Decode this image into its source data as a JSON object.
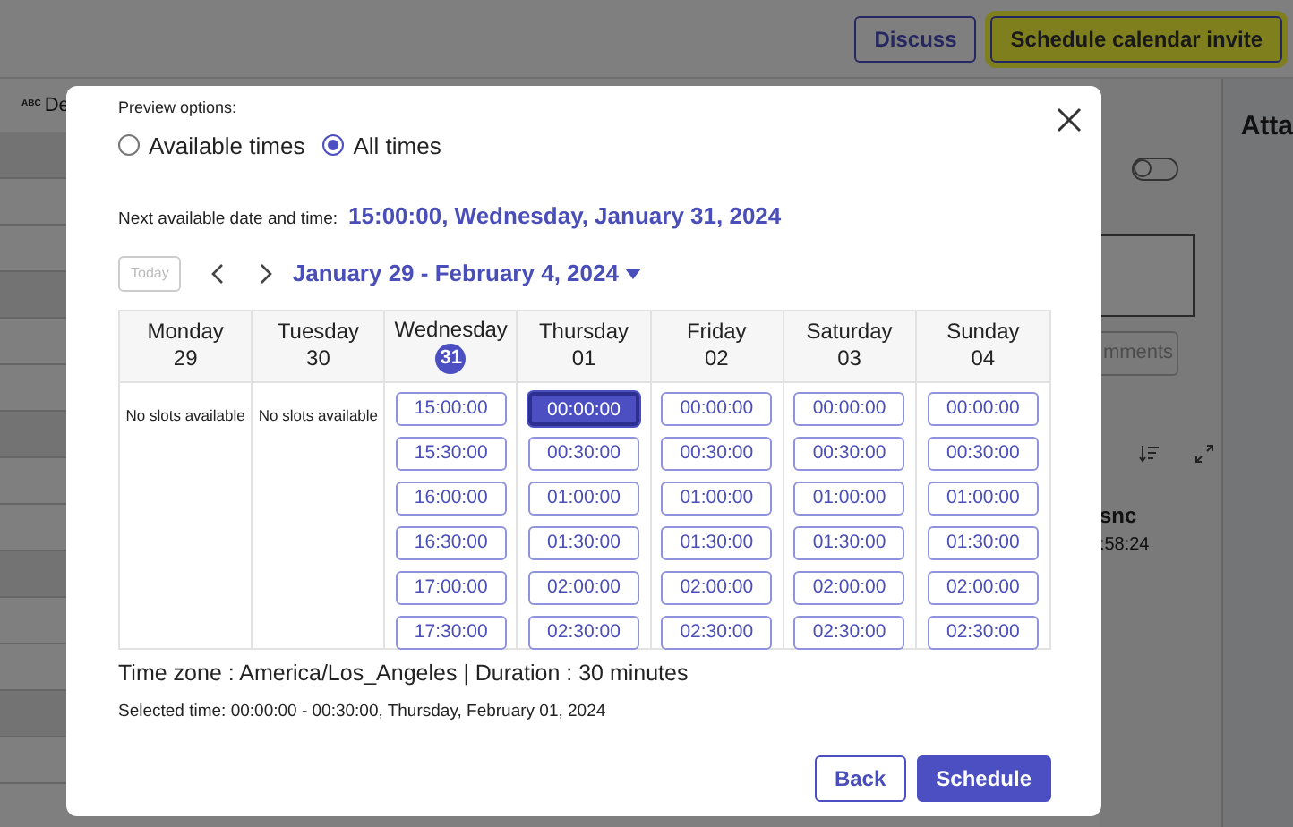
{
  "background": {
    "abc_label": "ABC",
    "field_label": "De",
    "buttons": [
      {
        "label": "Discuss",
        "kind": "outline",
        "highlighted": false
      },
      {
        "label": "Schedule calendar invite",
        "kind": "primary",
        "highlighted": true
      }
    ],
    "toggle_on": false,
    "comments_button": "mments",
    "activity_name": "snc",
    "activity_time": ":58:24",
    "panel_heading": "Atta"
  },
  "dialog": {
    "preview_label": "Preview options:",
    "preview_options": [
      {
        "label": "Available times",
        "selected": false
      },
      {
        "label": "All times",
        "selected": true
      }
    ],
    "next_label": "Next available date and time:",
    "next_value": "15:00:00, Wednesday, January 31, 2024",
    "today_button": {
      "label": "Today",
      "disabled": true
    },
    "range": "January 29 - February 4, 2024",
    "days": [
      {
        "name": "Monday",
        "date": "29",
        "today": false,
        "empty_text": "No slots available"
      },
      {
        "name": "Tuesday",
        "date": "30",
        "today": false,
        "empty_text": "No slots available"
      },
      {
        "name": "Wednesday",
        "date": "31",
        "today": true,
        "slots": [
          {
            "time": "15:00:00",
            "selected": false
          },
          {
            "time": "15:30:00",
            "selected": false
          },
          {
            "time": "16:00:00",
            "selected": false
          },
          {
            "time": "16:30:00",
            "selected": false
          },
          {
            "time": "17:00:00",
            "selected": false
          },
          {
            "time": "17:30:00",
            "selected": false
          }
        ]
      },
      {
        "name": "Thursday",
        "date": "01",
        "today": false,
        "slots": [
          {
            "time": "00:00:00",
            "selected": true
          },
          {
            "time": "00:30:00",
            "selected": false
          },
          {
            "time": "01:00:00",
            "selected": false
          },
          {
            "time": "01:30:00",
            "selected": false
          },
          {
            "time": "02:00:00",
            "selected": false
          },
          {
            "time": "02:30:00",
            "selected": false
          }
        ]
      },
      {
        "name": "Friday",
        "date": "02",
        "today": false,
        "slots": [
          {
            "time": "00:00:00",
            "selected": false
          },
          {
            "time": "00:30:00",
            "selected": false
          },
          {
            "time": "01:00:00",
            "selected": false
          },
          {
            "time": "01:30:00",
            "selected": false
          },
          {
            "time": "02:00:00",
            "selected": false
          },
          {
            "time": "02:30:00",
            "selected": false
          }
        ]
      },
      {
        "name": "Saturday",
        "date": "03",
        "today": false,
        "slots": [
          {
            "time": "00:00:00",
            "selected": false
          },
          {
            "time": "00:30:00",
            "selected": false
          },
          {
            "time": "01:00:00",
            "selected": false
          },
          {
            "time": "01:30:00",
            "selected": false
          },
          {
            "time": "02:00:00",
            "selected": false
          },
          {
            "time": "02:30:00",
            "selected": false
          }
        ]
      },
      {
        "name": "Sunday",
        "date": "04",
        "today": false,
        "slots": [
          {
            "time": "00:00:00",
            "selected": false
          },
          {
            "time": "00:30:00",
            "selected": false
          },
          {
            "time": "01:00:00",
            "selected": false
          },
          {
            "time": "01:30:00",
            "selected": false
          },
          {
            "time": "02:00:00",
            "selected": false
          },
          {
            "time": "02:30:00",
            "selected": false
          }
        ]
      }
    ],
    "timezone": "Time zone : America/Los_Angeles | Duration : 30 minutes",
    "selected_time": "Selected time: 00:00:00 - 00:30:00, Thursday, February 01, 2024",
    "buttons": [
      {
        "label": "Back",
        "kind": "outline"
      },
      {
        "label": "Schedule",
        "kind": "primary"
      }
    ]
  }
}
